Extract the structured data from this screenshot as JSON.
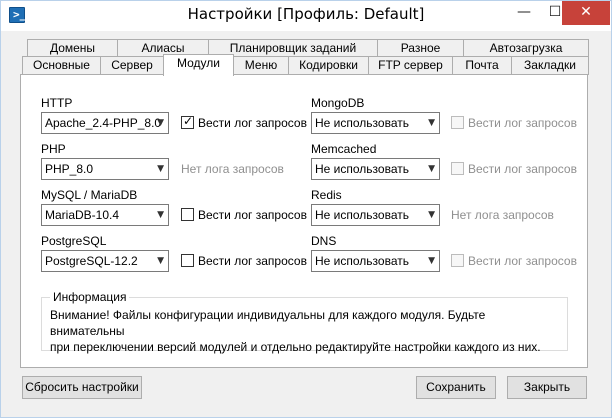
{
  "window": {
    "title": "Настройки [Профиль: Default]",
    "icon": "terminal-icon",
    "minimize_glyph": "—",
    "maximize_glyph": "☐",
    "close_glyph": "✕"
  },
  "tabs_row1": [
    "Домены",
    "Алиасы",
    "Планировщик заданий",
    "Разное",
    "Автозагрузка"
  ],
  "tabs_row2": [
    "Основные",
    "Сервер",
    "Модули",
    "Меню",
    "Кодировки",
    "FTP сервер",
    "Почта",
    "Закладки"
  ],
  "active_tab": "Модули",
  "modules_left": {
    "http": {
      "label": "HTTP",
      "value": "Apache_2.4-PHP_8.0",
      "checkbox_label": "Вести лог запросов",
      "checked": true
    },
    "php": {
      "label": "PHP",
      "value": "PHP_8.0",
      "note": "Нет лога запросов"
    },
    "mysql": {
      "label": "MySQL / MariaDB",
      "value": "MariaDB-10.4",
      "checkbox_label": "Вести лог запросов",
      "checked": false
    },
    "postgresql": {
      "label": "PostgreSQL",
      "value": "PostgreSQL-12.2",
      "checkbox_label": "Вести лог запросов",
      "checked": false
    }
  },
  "modules_right": {
    "mongodb": {
      "label": "MongoDB",
      "value": "Не использовать",
      "checkbox_label": "Вести лог запросов",
      "checked": false,
      "disabled": true
    },
    "memcached": {
      "label": "Memcached",
      "value": "Не использовать",
      "checkbox_label": "Вести лог запросов",
      "checked": false,
      "disabled": true
    },
    "redis": {
      "label": "Redis",
      "value": "Не использовать",
      "note": "Нет лога запросов"
    },
    "dns": {
      "label": "DNS",
      "value": "Не использовать",
      "checkbox_label": "Вести лог запросов",
      "checked": false,
      "disabled": true
    }
  },
  "info": {
    "title": "Информация",
    "line1": "Внимание! Файлы конфигурации индивидуальны для каждого модуля. Будьте внимательны",
    "line2": "при переключении версий модулей и отдельно редактируйте настройки каждого из них."
  },
  "buttons": {
    "reset": "Сбросить настройки",
    "save": "Сохранить",
    "close": "Закрыть"
  },
  "colors": {
    "close_button": "#c7423a",
    "app_icon": "#1f6fb5",
    "muted_text": "#8f8f8f"
  }
}
